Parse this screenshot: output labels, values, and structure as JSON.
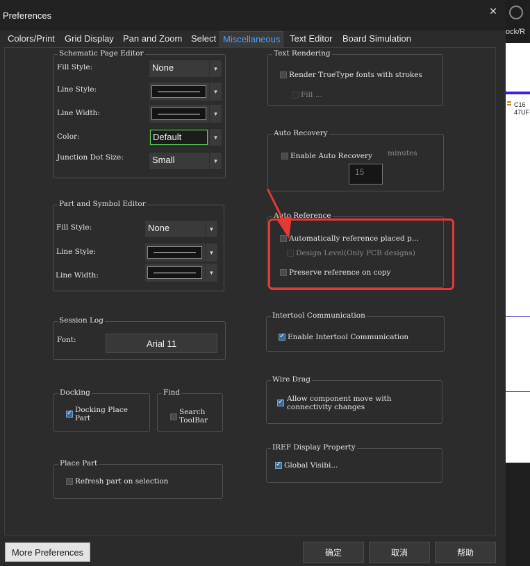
{
  "window": {
    "title": "Preferences"
  },
  "background_app": {
    "tab_text": "ock/R",
    "part_ref": "C16",
    "part_value": "47UF"
  },
  "tabs": [
    {
      "label": "Colors/Print"
    },
    {
      "label": "Grid Display"
    },
    {
      "label": "Pan and Zoom"
    },
    {
      "label": "Select"
    },
    {
      "label": "Miscellaneous",
      "active": true
    },
    {
      "label": "Text Editor"
    },
    {
      "label": "Board Simulation"
    }
  ],
  "schematic": {
    "title": "Schematic Page Editor",
    "fill_style_label": "Fill Style:",
    "fill_style_value": "None",
    "line_style_label": "Line Style:",
    "line_width_label": "Line Width:",
    "color_label": "Color:",
    "color_value": "Default",
    "junction_label": "Junction Dot Size:",
    "junction_value": "Small"
  },
  "part_symbol": {
    "title": "Part and Symbol Editor",
    "fill_style_label": "Fill Style:",
    "fill_style_value": "None",
    "line_style_label": "Line Style:",
    "line_width_label": "Line Width:"
  },
  "session_log": {
    "title": "Session Log",
    "font_label": "Font:",
    "font_value": "Arial 11"
  },
  "docking": {
    "title": "Docking",
    "option_line1": "Docking Place",
    "option_line2": "Part",
    "checked": true
  },
  "find": {
    "title": "Find",
    "option_line1": "Search",
    "option_line2": "ToolBar",
    "checked": false
  },
  "place_part": {
    "title": "Place Part",
    "option": "Refresh part on selection",
    "checked": false
  },
  "text_rendering": {
    "title": "Text Rendering",
    "option": "Render TrueType fonts with strokes",
    "fill": "Fill ...",
    "checked": false
  },
  "auto_recovery": {
    "title": "Auto Recovery",
    "option": "Enable Auto Recovery",
    "minutes_label": "minutes",
    "minutes_value": "15",
    "checked": false
  },
  "auto_reference": {
    "title": "Auto Reference",
    "option1": "Automatically reference placed p...",
    "option2": "Design Level(Only PCB designs)",
    "option3": "Preserve reference on copy"
  },
  "intertool": {
    "title": "Intertool Communication",
    "option": "Enable Intertool Communication",
    "checked": true
  },
  "wire_drag": {
    "title": "Wire Drag",
    "option_line1": "Allow component move with",
    "option_line2": "connectivity changes",
    "checked": true
  },
  "iref": {
    "title": "IREF Display Property",
    "option": "Global Visibi...",
    "checked": true
  },
  "buttons": {
    "more": "More Preferences",
    "ok": "确定",
    "cancel": "取消",
    "help": "帮助"
  },
  "colors": {
    "accent": "#4aa3ff",
    "highlight_red": "#e53935",
    "focus_green": "#5ad35a"
  }
}
